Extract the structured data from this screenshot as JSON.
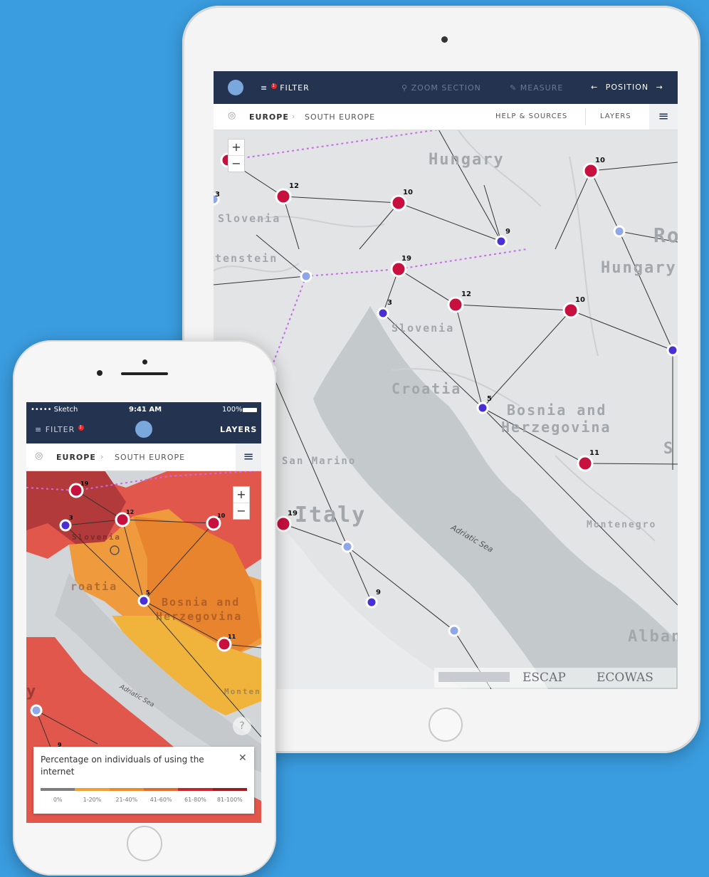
{
  "tablet": {
    "toolbar": {
      "filter_label": "FILTER",
      "filter_badge": "1",
      "zoom_section_label": "ZOOM SECTION",
      "measure_label": "MEASURE",
      "position_label": "POSITION"
    },
    "breadcrumb": {
      "level1": "EUROPE",
      "level2": "SOUTH EUROPE",
      "help_label": "HELP & SOURCES",
      "layers_label": "LAYERS"
    },
    "map": {
      "countries": [
        "Hungary",
        "Slovenia",
        "tenstein",
        "Hungary",
        "Slovenia",
        "Croatia",
        "Bosnia and",
        "Herzegovina",
        "San Marino",
        "Italy",
        "Montenegro",
        "Alban",
        "Ro",
        "S"
      ],
      "sea": "Adriatic Sea",
      "node_counts": [
        "10",
        "12",
        "10",
        "9",
        "19",
        "3",
        "12",
        "10",
        "5",
        "11",
        "19",
        "9",
        "3"
      ],
      "logos": [
        "ESCAP",
        "ECOWAS"
      ]
    },
    "zoom": {
      "in": "+",
      "out": "−"
    }
  },
  "phone": {
    "status": {
      "carrier": "••••• Sketch",
      "time": "9:41 AM",
      "battery": "100%"
    },
    "toolbar": {
      "filter_label": "FILTER",
      "filter_badge": "1",
      "layers_label": "LAYERS"
    },
    "breadcrumb": {
      "level1": "EUROPE",
      "level2": "SOUTH EUROPE"
    },
    "map": {
      "countries": [
        "Slovenia",
        "roatia",
        "Bosnia and",
        "Herzegovina",
        "Monten",
        "y"
      ],
      "sea": "Adriatic Sea",
      "node_counts": [
        "19",
        "3",
        "12",
        "10",
        "5",
        "11",
        "9"
      ]
    },
    "zoom": {
      "in": "+",
      "out": "−"
    },
    "help_icon": "?",
    "legend": {
      "title": "Percentage on individuals of using the internet",
      "close": "✕",
      "buckets": [
        {
          "label": "0%",
          "color": "#7d7d7d"
        },
        {
          "label": "1-20%",
          "color": "#f0a030"
        },
        {
          "label": "21-40%",
          "color": "#ef8a28"
        },
        {
          "label": "41-60%",
          "color": "#e36a2a"
        },
        {
          "label": "61-80%",
          "color": "#c8242c"
        },
        {
          "label": "81-100%",
          "color": "#9c1a20"
        }
      ]
    }
  },
  "colors": {
    "background": "#3a9de0",
    "navbar": "#24334f",
    "node_red": "#c8103f",
    "node_blue": "#4a2fd6",
    "node_light": "#8fa6e8"
  }
}
